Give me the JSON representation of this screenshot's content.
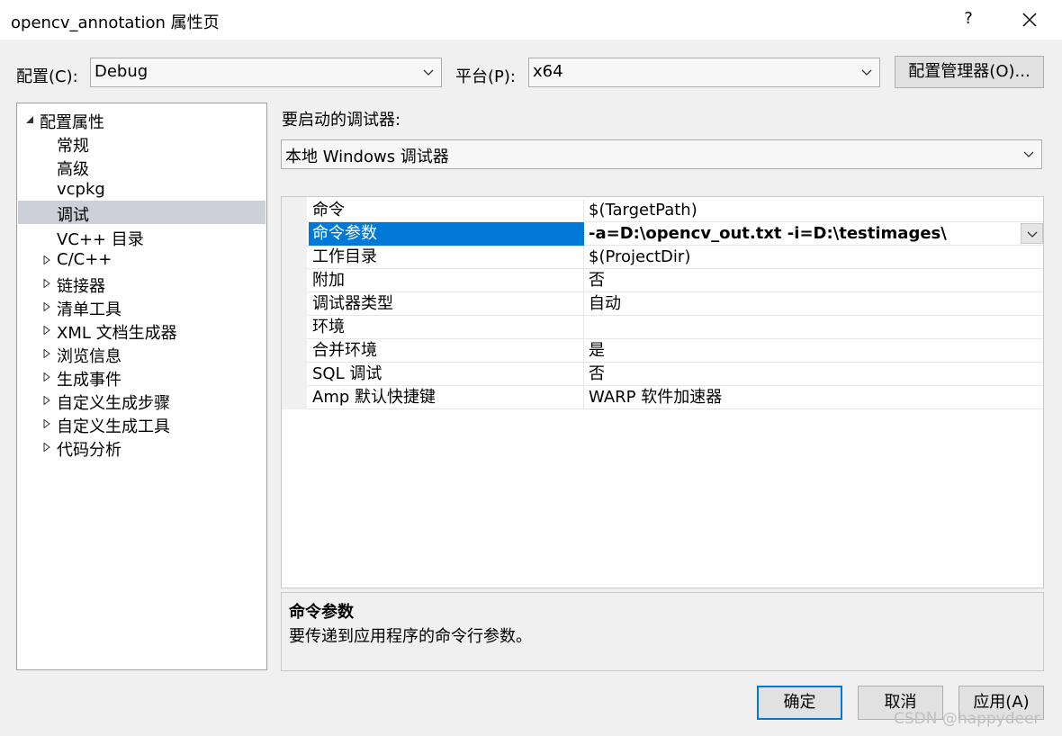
{
  "window": {
    "title": "opencv_annotation 属性页",
    "help_label": "?"
  },
  "config_bar": {
    "config_label": "配置(C):",
    "config_value": "Debug",
    "platform_label": "平台(P):",
    "platform_value": "x64",
    "manager_button": "配置管理器(O)..."
  },
  "tree": {
    "root": "配置属性",
    "items": [
      {
        "label": "常规"
      },
      {
        "label": "高级"
      },
      {
        "label": "vcpkg"
      },
      {
        "label": "调试"
      },
      {
        "label": "VC++ 目录"
      },
      {
        "label": "C/C++"
      },
      {
        "label": "链接器"
      },
      {
        "label": "清单工具"
      },
      {
        "label": "XML 文档生成器"
      },
      {
        "label": "浏览信息"
      },
      {
        "label": "生成事件"
      },
      {
        "label": "自定义生成步骤"
      },
      {
        "label": "自定义生成工具"
      },
      {
        "label": "代码分析"
      }
    ]
  },
  "debugger": {
    "label": "要启动的调试器:",
    "value": "本地 Windows 调试器"
  },
  "properties": [
    {
      "name": "命令",
      "value": "$(TargetPath)"
    },
    {
      "name": "命令参数",
      "value": "-a=D:\\opencv_out.txt -i=D:\\testimages\\"
    },
    {
      "name": "工作目录",
      "value": "$(ProjectDir)"
    },
    {
      "name": "附加",
      "value": "否"
    },
    {
      "name": "调试器类型",
      "value": "自动"
    },
    {
      "name": "环境",
      "value": ""
    },
    {
      "name": "合并环境",
      "value": "是"
    },
    {
      "name": "SQL 调试",
      "value": "否"
    },
    {
      "name": "Amp 默认快捷键",
      "value": "WARP 软件加速器"
    }
  ],
  "description": {
    "title": "命令参数",
    "text": "要传递到应用程序的命令行参数。"
  },
  "buttons": {
    "ok": "确定",
    "cancel": "取消",
    "apply": "应用(A)"
  },
  "watermark": "CSDN @happydeer",
  "colors": {
    "selection_blue": "#0078d7",
    "tree_selection": "#cdd0d8",
    "dialog_bg": "#f0f0f0"
  }
}
